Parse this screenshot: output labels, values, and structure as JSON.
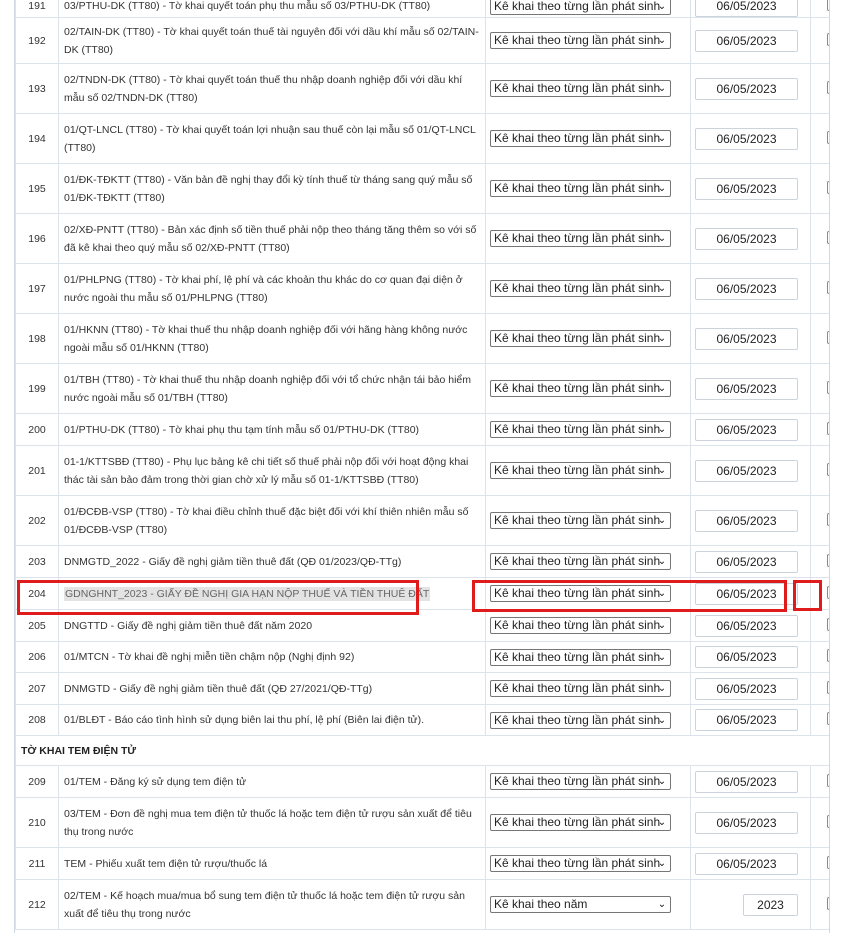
{
  "table": {
    "rows": [
      {
        "num": "191",
        "name": "03/PTHU-DK (TT80) - Tờ khai quyết toán phụ thu mẫu số 03/PTHU-DK (TT80)",
        "select": "Kê khai theo từng lần phát sinh",
        "date": "06/05/2023",
        "h": 22
      },
      {
        "num": "192",
        "name": "02/TAIN-DK (TT80) - Tờ khai quyết toán thuế tài nguyên đối với dầu khí mẫu số 02/TAIN-DK (TT80)",
        "select": "Kê khai theo từng lần phát sinh",
        "date": "06/05/2023",
        "h": 46
      },
      {
        "num": "193",
        "name": "02/TNDN-DK (TT80) - Tờ khai quyết toán thuế thu nhập doanh nghiệp đối với dầu khí mẫu số 02/TNDN-DK (TT80)",
        "select": "Kê khai theo từng lần phát sinh",
        "date": "06/05/2023",
        "h": 50
      },
      {
        "num": "194",
        "name": "01/QT-LNCL (TT80) - Tờ khai quyết toán lợi nhuận sau thuế còn lại mẫu số 01/QT-LNCL (TT80)",
        "select": "Kê khai theo từng lần phát sinh",
        "date": "06/05/2023",
        "h": 50
      },
      {
        "num": "195",
        "name": "01/ĐK-TĐKTT (TT80) - Văn bản đề nghị thay đổi kỳ tính thuế từ tháng sang quý mẫu số 01/ĐK-TĐKTT (TT80)",
        "select": "Kê khai theo từng lần phát sinh",
        "date": "06/05/2023",
        "h": 50
      },
      {
        "num": "196",
        "name": "02/XĐ-PNTT (TT80) - Bản xác định số tiền thuế phải nộp theo tháng tăng thêm so với số đã kê khai theo quý mẫu số 02/XĐ-PNTT (TT80)",
        "select": "Kê khai theo từng lần phát sinh",
        "date": "06/05/2023",
        "h": 50
      },
      {
        "num": "197",
        "name": "01/PHLPNG (TT80) - Tờ khai phí, lệ phí và các khoản thu khác do cơ quan đại diện ở nước ngoài thu mẫu số 01/PHLPNG (TT80)",
        "select": "Kê khai theo từng lần phát sinh",
        "date": "06/05/2023",
        "h": 50
      },
      {
        "num": "198",
        "name": "01/HKNN (TT80) - Tờ khai thuế thu nhập doanh nghiệp đối với hãng hàng không nước ngoài mẫu số 01/HKNN (TT80)",
        "select": "Kê khai theo từng lần phát sinh",
        "date": "06/05/2023",
        "h": 50
      },
      {
        "num": "199",
        "name": "01/TBH (TT80) - Tờ khai thuế thu nhập doanh nghiệp đối với tổ chức nhận tái bảo hiểm nước ngoài mẫu số 01/TBH (TT80)",
        "select": "Kê khai theo từng lần phát sinh",
        "date": "06/05/2023",
        "h": 50
      },
      {
        "num": "200",
        "name": "01/PTHU-DK (TT80) - Tờ khai phụ thu tạm tính mẫu số 01/PTHU-DK (TT80)",
        "select": "Kê khai theo từng lần phát sinh",
        "date": "06/05/2023",
        "h": 32
      },
      {
        "num": "201",
        "name": "01-1/KTTSBĐ (TT80) - Phụ lục bảng kê chi tiết số thuế phải nộp đối với hoạt động khai thác tài sản bảo đảm trong thời gian chờ xử lý mẫu số 01-1/KTTSBĐ (TT80)",
        "select": "Kê khai theo từng lần phát sinh",
        "date": "06/05/2023",
        "h": 50
      },
      {
        "num": "202",
        "name": "01/ĐCĐB-VSP (TT80) - Tờ khai điều chỉnh thuế đặc biệt đối với khí thiên nhiên mẫu số 01/ĐCĐB-VSP (TT80)",
        "select": "Kê khai theo từng lần phát sinh",
        "date": "06/05/2023",
        "h": 50
      },
      {
        "num": "203",
        "name": "DNMGTD_2022 - Giấy đề nghị giảm tiền thuê đất (QĐ 01/2023/QĐ-TTg)",
        "select": "Kê khai theo từng lần phát sinh",
        "date": "06/05/2023",
        "h": 32
      },
      {
        "num": "204",
        "name": "GDNGHNT_2023 - GIẤY ĐỀ NGHỊ GIA HẠN NỘP THUẾ VÀ TIỀN THUÊ ĐẤT",
        "select": "Kê khai theo từng lần phát sinh",
        "date": "06/05/2023",
        "h": 32,
        "highlight": true
      },
      {
        "num": "205",
        "name": "DNGTTD - Giấy đề nghị giảm tiền thuê đất năm 2020",
        "select": "Kê khai theo từng lần phát sinh",
        "date": "06/05/2023",
        "h": 32
      },
      {
        "num": "206",
        "name": "01/MTCN - Tờ khai đề nghị miễn tiền chậm nộp (Nghị định 92)",
        "select": "Kê khai theo từng lần phát sinh",
        "date": "06/05/2023",
        "h": 31
      },
      {
        "num": "207",
        "name": "DNMGTD - Giấy đề nghị giảm tiền thuê đất (QĐ 27/2021/QĐ-TTg)",
        "select": "Kê khai theo từng lần phát sinh",
        "date": "06/05/2023",
        "h": 32
      },
      {
        "num": "208",
        "name": "01/BLĐT - Báo cáo tình hình sử dụng biên lai thu phí, lệ phí (Biên lai điện tử).",
        "select": "Kê khai theo từng lần phát sinh",
        "date": "06/05/2023",
        "h": 31
      }
    ],
    "section_label": "TỜ KHAI TEM ĐIỆN TỬ",
    "rows2": [
      {
        "num": "209",
        "name": "01/TEM - Đăng ký sử dụng tem điện tử",
        "select": "Kê khai theo từng lần phát sinh",
        "date": "06/05/2023",
        "h": 32
      },
      {
        "num": "210",
        "name": "03/TEM - Đơn đề nghị mua tem điện tử thuốc lá hoặc tem điện tử rượu sản xuất để tiêu thụ trong nước",
        "select": "Kê khai theo từng lần phát sinh",
        "date": "06/05/2023",
        "h": 50
      },
      {
        "num": "211",
        "name": "TEM - Phiếu xuất tem điện tử rượu/thuốc lá",
        "select": "Kê khai theo từng lần phát sinh",
        "date": "06/05/2023",
        "h": 32
      },
      {
        "num": "212",
        "name": "02/TEM - Kế hoạch mua/mua bổ sung tem điện tử thuốc lá hoặc tem điện tử rượu sản xuất để tiêu thụ trong nước",
        "select": "Kê khai theo năm",
        "date": "2023",
        "h": 50,
        "year": true
      }
    ]
  },
  "icons": {
    "select_arrow": "chevron-down-icon",
    "checkbox": "checkbox-icon"
  },
  "colors": {
    "highlight_border": "#e01b1b",
    "row_border": "#dde3ea",
    "highlight_text_bg": "#e3e3e3"
  }
}
